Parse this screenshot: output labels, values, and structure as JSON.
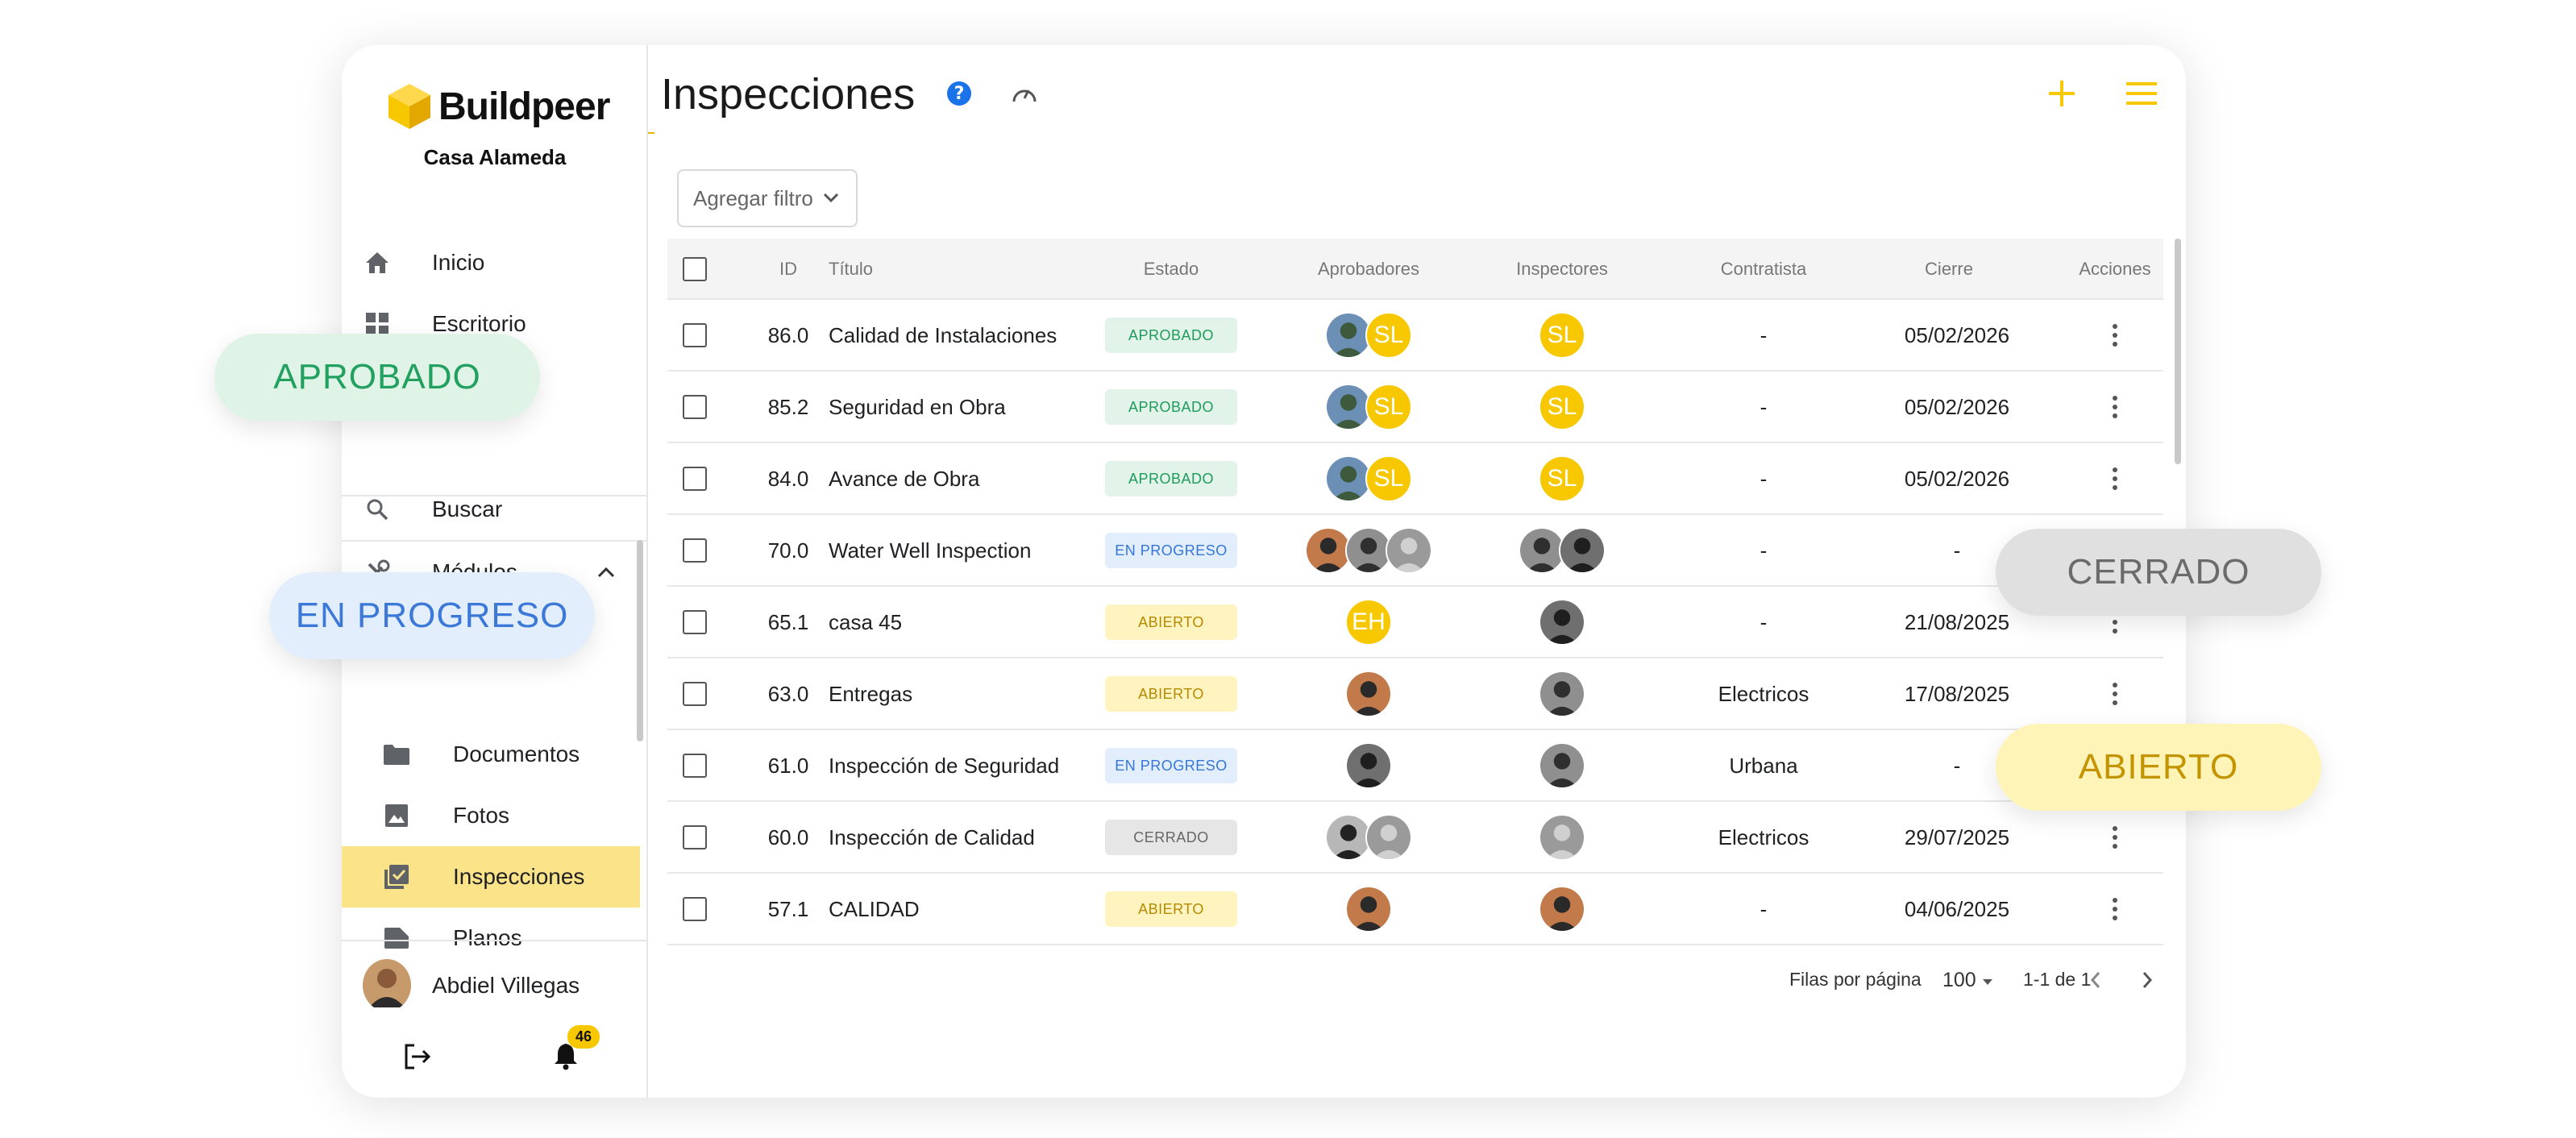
{
  "app": {
    "name": "Buildpeer",
    "project": "Casa Alameda"
  },
  "colors": {
    "brand": "#f7c800",
    "active_nav": "#fbe38a",
    "aprobado": "#1e9b5b",
    "en_progreso": "#3476d8",
    "abierto": "#b58a00",
    "cerrado": "#666666"
  },
  "sidebar": {
    "items": [
      {
        "label": "Inicio",
        "icon": "home-icon"
      },
      {
        "label": "Escritorio",
        "icon": "dashboard-icon"
      },
      {
        "label": "Buscar",
        "icon": "search-icon"
      },
      {
        "label": "Módulos",
        "icon": "tools-icon"
      }
    ],
    "modules": [
      {
        "label": "Documentos",
        "icon": "folder-icon"
      },
      {
        "label": "Fotos",
        "icon": "image-icon"
      },
      {
        "label": "Inspecciones",
        "icon": "checklist-icon",
        "active": true
      },
      {
        "label": "Planos",
        "icon": "plans-icon"
      }
    ],
    "user": {
      "name": "Abdiel Villegas"
    },
    "notifications": "46"
  },
  "header": {
    "title": "Inspecciones"
  },
  "filter": {
    "label": "Agregar filtro"
  },
  "table": {
    "columns": [
      "ID",
      "Título",
      "Estado",
      "Aprobadores",
      "Inspectores",
      "Contratista",
      "Cierre",
      "Acciones"
    ],
    "rows": [
      {
        "id": "86.0",
        "title": "Calidad de Instalaciones",
        "status": "APROBADO",
        "status_key": "aprobado",
        "approvers": [
          "photo-a",
          "SL"
        ],
        "inspectors": [
          "SL"
        ],
        "contractor": "-",
        "close": "05/02/2026"
      },
      {
        "id": "85.2",
        "title": "Seguridad en Obra",
        "status": "APROBADO",
        "status_key": "aprobado",
        "approvers": [
          "photo-a",
          "SL"
        ],
        "inspectors": [
          "SL"
        ],
        "contractor": "-",
        "close": "05/02/2026"
      },
      {
        "id": "84.0",
        "title": "Avance de Obra",
        "status": "APROBADO",
        "status_key": "aprobado",
        "approvers": [
          "photo-a",
          "SL"
        ],
        "inspectors": [
          "SL"
        ],
        "contractor": "-",
        "close": "05/02/2026"
      },
      {
        "id": "70.0",
        "title": "Water Well Inspection",
        "status": "EN PROGRESO",
        "status_key": "progreso",
        "approvers": [
          "photo-b",
          "photo-c",
          "photo-d"
        ],
        "inspectors": [
          "photo-c",
          "photo-e"
        ],
        "contractor": "-",
        "close": "-"
      },
      {
        "id": "65.1",
        "title": "casa 45",
        "status": "ABIERTO",
        "status_key": "abierto",
        "approvers": [
          "EH"
        ],
        "inspectors": [
          "photo-e"
        ],
        "contractor": "-",
        "close": "21/08/2025"
      },
      {
        "id": "63.0",
        "title": "Entregas",
        "status": "ABIERTO",
        "status_key": "abierto",
        "approvers": [
          "photo-b"
        ],
        "inspectors": [
          "photo-c"
        ],
        "contractor": "Electricos",
        "close": "17/08/2025"
      },
      {
        "id": "61.0",
        "title": "Inspección de Seguridad",
        "status": "EN PROGRESO",
        "status_key": "progreso",
        "approvers": [
          "photo-e"
        ],
        "inspectors": [
          "photo-c"
        ],
        "contractor": "Urbana",
        "close": "-"
      },
      {
        "id": "60.0",
        "title": "Inspección de Calidad",
        "status": "CERRADO",
        "status_key": "cerrado",
        "approvers": [
          "photo-f",
          "photo-d"
        ],
        "inspectors": [
          "photo-d"
        ],
        "contractor": "Electricos",
        "close": "29/07/2025"
      },
      {
        "id": "57.1",
        "title": "CALIDAD",
        "status": "ABIERTO",
        "status_key": "abierto",
        "approvers": [
          "photo-b"
        ],
        "inspectors": [
          "photo-b"
        ],
        "contractor": "-",
        "close": "04/06/2025"
      }
    ]
  },
  "pagination": {
    "rows_label": "Filas por página",
    "rows_value": "100",
    "range": "1-1 de 1"
  },
  "chips": {
    "aprobado": "APROBADO",
    "en_progreso": "EN PROGRESO",
    "cerrado": "CERRADO",
    "abierto": "ABIERTO"
  }
}
